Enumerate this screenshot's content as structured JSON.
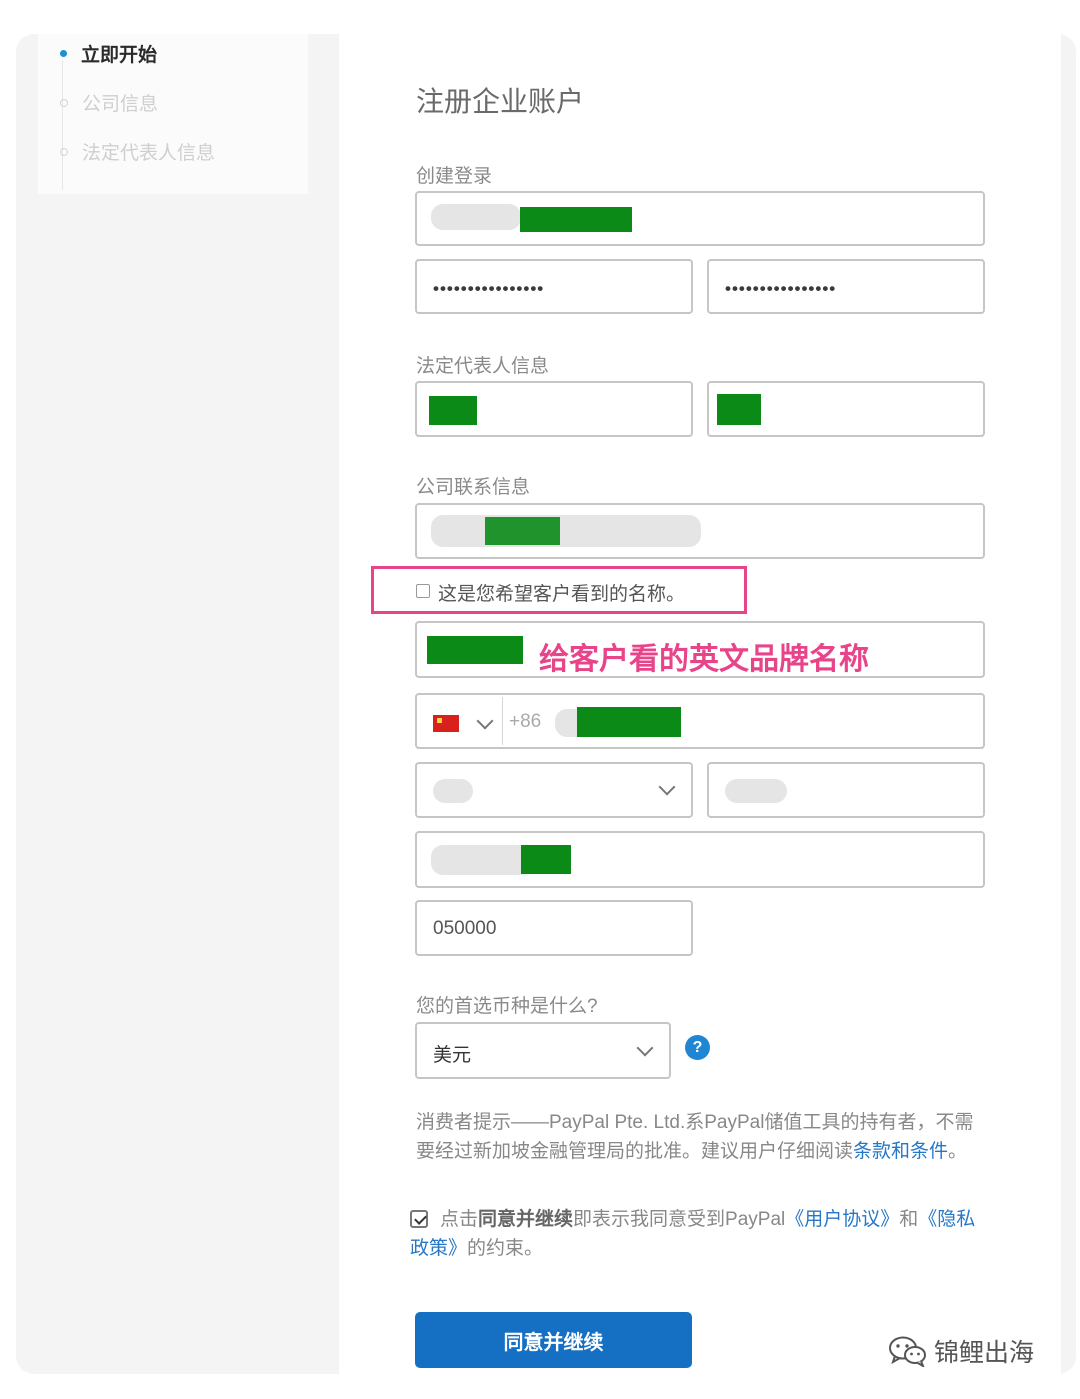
{
  "sidebar": {
    "steps": [
      {
        "label": "立即开始",
        "state": "active"
      },
      {
        "label": "公司信息",
        "state": "inactive"
      },
      {
        "label": "法定代表人信息",
        "state": "inactive"
      }
    ]
  },
  "form": {
    "title": "注册企业账户",
    "login_section": "创建登录",
    "password_mask": "••••••••••••••••",
    "confirm_password_mask": "••••••••••••••••",
    "legal_rep_section": "法定代表人信息",
    "contact_section": "公司联系信息",
    "display_name_checkbox": "这是您希望客户看到的名称。",
    "annotation": "给客户看的英文品牌名称",
    "phone_prefix": "+86",
    "postal_code": "050000",
    "currency_question": "您的首选币种是什么?",
    "currency_value": "美元",
    "help_icon_label": "?",
    "disclaimer_text": "消费者提示——PayPal Pte. Ltd.系PayPal储值工具的持有者，不需要经过新加坡金融管理局的批准。建议用户仔细阅读",
    "terms_link": "条款和条件",
    "disclaimer_end": "。",
    "agree_prefix": "点击",
    "agree_bold": "同意并继续",
    "agree_middle": "即表示我同意受到PayPal",
    "user_agreement_link": "《用户协议》",
    "agree_and": "和",
    "privacy_link": "《隐私政策》",
    "agree_end": "的约束。",
    "submit_label": "同意并继续"
  },
  "watermark": {
    "text": "锦鲤出海",
    "icon": "wechat-icon"
  },
  "colors": {
    "accent": "#1570c4",
    "annotation": "#e8448a",
    "redaction": "#0b8a17"
  }
}
